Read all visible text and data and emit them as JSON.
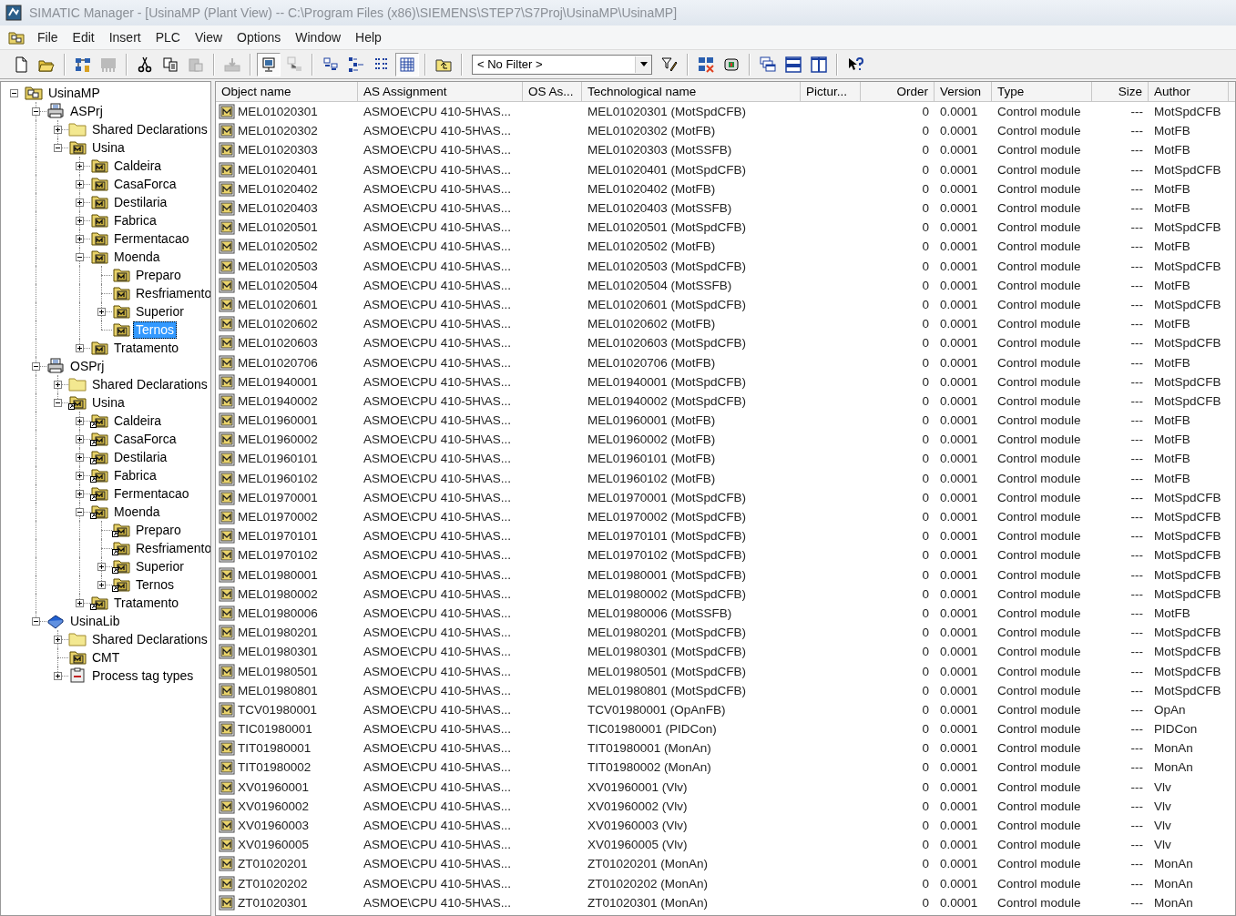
{
  "window": {
    "title": "SIMATIC Manager - [UsinaMP (Plant View) -- C:\\Program Files (x86)\\SIEMENS\\STEP7\\S7Proj\\UsinaMP\\UsinaMP]"
  },
  "menu": [
    "File",
    "Edit",
    "Insert",
    "PLC",
    "View",
    "Options",
    "Window",
    "Help"
  ],
  "toolbar": [
    {
      "kind": "new",
      "disabled": false,
      "pressed": false
    },
    {
      "kind": "open",
      "disabled": false,
      "pressed": false
    },
    {
      "kind": "separator"
    },
    {
      "kind": "network",
      "disabled": false,
      "pressed": false
    },
    {
      "kind": "simulate",
      "disabled": true,
      "pressed": false
    },
    {
      "kind": "separator"
    },
    {
      "kind": "cut",
      "disabled": false,
      "pressed": false
    },
    {
      "kind": "copy",
      "disabled": false,
      "pressed": false
    },
    {
      "kind": "paste",
      "disabled": true,
      "pressed": false
    },
    {
      "kind": "separator"
    },
    {
      "kind": "download",
      "disabled": true,
      "pressed": false
    },
    {
      "kind": "separator"
    },
    {
      "kind": "online",
      "disabled": false,
      "pressed": true
    },
    {
      "kind": "offline",
      "disabled": true,
      "pressed": false
    },
    {
      "kind": "separator"
    },
    {
      "kind": "large-icons",
      "disabled": false,
      "pressed": false
    },
    {
      "kind": "small-icons",
      "disabled": false,
      "pressed": false
    },
    {
      "kind": "list",
      "disabled": false,
      "pressed": false
    },
    {
      "kind": "details",
      "disabled": false,
      "pressed": true
    },
    {
      "kind": "separator"
    },
    {
      "kind": "up-level",
      "disabled": false,
      "pressed": false
    },
    {
      "kind": "separator"
    },
    {
      "kind": "filter",
      "value": "< No Filter >"
    },
    {
      "kind": "filter-edit",
      "disabled": false,
      "pressed": false
    },
    {
      "kind": "separator"
    },
    {
      "kind": "config",
      "disabled": false,
      "pressed": false
    },
    {
      "kind": "module",
      "disabled": false,
      "pressed": false
    },
    {
      "kind": "separator"
    },
    {
      "kind": "cascade",
      "disabled": false,
      "pressed": false
    },
    {
      "kind": "tile-horizontal",
      "disabled": false,
      "pressed": false
    },
    {
      "kind": "tile-vertical",
      "disabled": false,
      "pressed": false
    },
    {
      "kind": "separator"
    },
    {
      "kind": "help",
      "disabled": false,
      "pressed": false
    }
  ],
  "tree": [
    {
      "label": "UsinaMP",
      "kind": "multiproject",
      "expanded": true,
      "selected": false,
      "children": [
        {
          "label": "ASPrj",
          "kind": "project",
          "expanded": true,
          "selected": false,
          "children": [
            {
              "label": "Shared Declarations",
              "kind": "folder",
              "expanded": false,
              "selected": false
            },
            {
              "label": "Usina",
              "kind": "plant",
              "expanded": true,
              "selected": false,
              "children": [
                {
                  "label": "Caldeira",
                  "kind": "plant",
                  "expanded": false,
                  "selected": false
                },
                {
                  "label": "CasaForca",
                  "kind": "plant",
                  "expanded": false,
                  "selected": false
                },
                {
                  "label": "Destilaria",
                  "kind": "plant",
                  "expanded": false,
                  "selected": false
                },
                {
                  "label": "Fabrica",
                  "kind": "plant",
                  "expanded": false,
                  "selected": false
                },
                {
                  "label": "Fermentacao",
                  "kind": "plant",
                  "expanded": false,
                  "selected": false
                },
                {
                  "label": "Moenda",
                  "kind": "plant",
                  "expanded": true,
                  "selected": false,
                  "children": [
                    {
                      "label": "Preparo",
                      "kind": "plant",
                      "selected": false
                    },
                    {
                      "label": "Resfriamento",
                      "kind": "plant",
                      "selected": false
                    },
                    {
                      "label": "Superior",
                      "kind": "plant",
                      "expanded": false,
                      "selected": false
                    },
                    {
                      "label": "Ternos",
                      "kind": "plant",
                      "selected": true
                    }
                  ]
                },
                {
                  "label": "Tratamento",
                  "kind": "plant",
                  "expanded": false,
                  "selected": false
                }
              ]
            }
          ]
        },
        {
          "label": "OSPrj",
          "kind": "project",
          "expanded": true,
          "selected": false,
          "children": [
            {
              "label": "Shared Declarations",
              "kind": "folder",
              "expanded": false,
              "selected": false
            },
            {
              "label": "Usina",
              "kind": "plant-link",
              "expanded": true,
              "selected": false,
              "children": [
                {
                  "label": "Caldeira",
                  "kind": "plant-link",
                  "expanded": false,
                  "selected": false
                },
                {
                  "label": "CasaForca",
                  "kind": "plant-link",
                  "expanded": false,
                  "selected": false
                },
                {
                  "label": "Destilaria",
                  "kind": "plant-link",
                  "expanded": false,
                  "selected": false
                },
                {
                  "label": "Fabrica",
                  "kind": "plant-link",
                  "expanded": false,
                  "selected": false
                },
                {
                  "label": "Fermentacao",
                  "kind": "plant-link",
                  "expanded": false,
                  "selected": false
                },
                {
                  "label": "Moenda",
                  "kind": "plant-link",
                  "expanded": true,
                  "selected": false,
                  "children": [
                    {
                      "label": "Preparo",
                      "kind": "plant-link",
                      "selected": false
                    },
                    {
                      "label": "Resfriamento",
                      "kind": "plant-link",
                      "selected": false
                    },
                    {
                      "label": "Superior",
                      "kind": "plant-link",
                      "expanded": false,
                      "selected": false
                    },
                    {
                      "label": "Ternos",
                      "kind": "plant-link",
                      "expanded": false,
                      "selected": false
                    }
                  ]
                },
                {
                  "label": "Tratamento",
                  "kind": "plant-link",
                  "expanded": false,
                  "selected": false
                }
              ]
            }
          ]
        },
        {
          "label": "UsinaLib",
          "kind": "library",
          "expanded": true,
          "selected": false,
          "children": [
            {
              "label": "Shared Declarations",
              "kind": "folder",
              "expanded": false,
              "selected": false
            },
            {
              "label": "CMT",
              "kind": "plant",
              "selected": false
            },
            {
              "label": "Process tag types",
              "kind": "tag-types",
              "expanded": false,
              "selected": false
            }
          ]
        }
      ]
    }
  ],
  "table": {
    "columns": [
      "Object name",
      "AS Assignment",
      "OS As...",
      "Technological name",
      "Pictur...",
      "Order",
      "Version",
      "Type",
      "Size",
      "Author"
    ],
    "rows": [
      {
        "object_name": "MEL01020301",
        "as_assignment": "ASMOE\\CPU 410-5H\\AS...",
        "technological_name": "MEL01020301 (MotSpdCFB)",
        "order": "0",
        "version": "0.0001",
        "type": "Control module",
        "size": "---",
        "author": "MotSpdCFB"
      },
      {
        "object_name": "MEL01020302",
        "as_assignment": "ASMOE\\CPU 410-5H\\AS...",
        "technological_name": "MEL01020302 (MotFB)",
        "order": "0",
        "version": "0.0001",
        "type": "Control module",
        "size": "---",
        "author": "MotFB"
      },
      {
        "object_name": "MEL01020303",
        "as_assignment": "ASMOE\\CPU 410-5H\\AS...",
        "technological_name": "MEL01020303 (MotSSFB)",
        "order": "0",
        "version": "0.0001",
        "type": "Control module",
        "size": "---",
        "author": "MotFB"
      },
      {
        "object_name": "MEL01020401",
        "as_assignment": "ASMOE\\CPU 410-5H\\AS...",
        "technological_name": "MEL01020401 (MotSpdCFB)",
        "order": "0",
        "version": "0.0001",
        "type": "Control module",
        "size": "---",
        "author": "MotSpdCFB"
      },
      {
        "object_name": "MEL01020402",
        "as_assignment": "ASMOE\\CPU 410-5H\\AS...",
        "technological_name": "MEL01020402 (MotFB)",
        "order": "0",
        "version": "0.0001",
        "type": "Control module",
        "size": "---",
        "author": "MotFB"
      },
      {
        "object_name": "MEL01020403",
        "as_assignment": "ASMOE\\CPU 410-5H\\AS...",
        "technological_name": "MEL01020403 (MotSSFB)",
        "order": "0",
        "version": "0.0001",
        "type": "Control module",
        "size": "---",
        "author": "MotFB"
      },
      {
        "object_name": "MEL01020501",
        "as_assignment": "ASMOE\\CPU 410-5H\\AS...",
        "technological_name": "MEL01020501 (MotSpdCFB)",
        "order": "0",
        "version": "0.0001",
        "type": "Control module",
        "size": "---",
        "author": "MotSpdCFB"
      },
      {
        "object_name": "MEL01020502",
        "as_assignment": "ASMOE\\CPU 410-5H\\AS...",
        "technological_name": "MEL01020502 (MotFB)",
        "order": "0",
        "version": "0.0001",
        "type": "Control module",
        "size": "---",
        "author": "MotFB"
      },
      {
        "object_name": "MEL01020503",
        "as_assignment": "ASMOE\\CPU 410-5H\\AS...",
        "technological_name": "MEL01020503 (MotSpdCFB)",
        "order": "0",
        "version": "0.0001",
        "type": "Control module",
        "size": "---",
        "author": "MotSpdCFB"
      },
      {
        "object_name": "MEL01020504",
        "as_assignment": "ASMOE\\CPU 410-5H\\AS...",
        "technological_name": "MEL01020504 (MotSSFB)",
        "order": "0",
        "version": "0.0001",
        "type": "Control module",
        "size": "---",
        "author": "MotFB"
      },
      {
        "object_name": "MEL01020601",
        "as_assignment": "ASMOE\\CPU 410-5H\\AS...",
        "technological_name": "MEL01020601 (MotSpdCFB)",
        "order": "0",
        "version": "0.0001",
        "type": "Control module",
        "size": "---",
        "author": "MotSpdCFB"
      },
      {
        "object_name": "MEL01020602",
        "as_assignment": "ASMOE\\CPU 410-5H\\AS...",
        "technological_name": "MEL01020602 (MotFB)",
        "order": "0",
        "version": "0.0001",
        "type": "Control module",
        "size": "---",
        "author": "MotFB"
      },
      {
        "object_name": "MEL01020603",
        "as_assignment": "ASMOE\\CPU 410-5H\\AS...",
        "technological_name": "MEL01020603 (MotSpdCFB)",
        "order": "0",
        "version": "0.0001",
        "type": "Control module",
        "size": "---",
        "author": "MotSpdCFB"
      },
      {
        "object_name": "MEL01020706",
        "as_assignment": "ASMOE\\CPU 410-5H\\AS...",
        "technological_name": "MEL01020706 (MotFB)",
        "order": "0",
        "version": "0.0001",
        "type": "Control module",
        "size": "---",
        "author": "MotFB"
      },
      {
        "object_name": "MEL01940001",
        "as_assignment": "ASMOE\\CPU 410-5H\\AS...",
        "technological_name": "MEL01940001 (MotSpdCFB)",
        "order": "0",
        "version": "0.0001",
        "type": "Control module",
        "size": "---",
        "author": "MotSpdCFB"
      },
      {
        "object_name": "MEL01940002",
        "as_assignment": "ASMOE\\CPU 410-5H\\AS...",
        "technological_name": "MEL01940002 (MotSpdCFB)",
        "order": "0",
        "version": "0.0001",
        "type": "Control module",
        "size": "---",
        "author": "MotSpdCFB"
      },
      {
        "object_name": "MEL01960001",
        "as_assignment": "ASMOE\\CPU 410-5H\\AS...",
        "technological_name": "MEL01960001 (MotFB)",
        "order": "0",
        "version": "0.0001",
        "type": "Control module",
        "size": "---",
        "author": "MotFB"
      },
      {
        "object_name": "MEL01960002",
        "as_assignment": "ASMOE\\CPU 410-5H\\AS...",
        "technological_name": "MEL01960002 (MotFB)",
        "order": "0",
        "version": "0.0001",
        "type": "Control module",
        "size": "---",
        "author": "MotFB"
      },
      {
        "object_name": "MEL01960101",
        "as_assignment": "ASMOE\\CPU 410-5H\\AS...",
        "technological_name": "MEL01960101 (MotFB)",
        "order": "0",
        "version": "0.0001",
        "type": "Control module",
        "size": "---",
        "author": "MotFB"
      },
      {
        "object_name": "MEL01960102",
        "as_assignment": "ASMOE\\CPU 410-5H\\AS...",
        "technological_name": "MEL01960102 (MotFB)",
        "order": "0",
        "version": "0.0001",
        "type": "Control module",
        "size": "---",
        "author": "MotFB"
      },
      {
        "object_name": "MEL01970001",
        "as_assignment": "ASMOE\\CPU 410-5H\\AS...",
        "technological_name": "MEL01970001 (MotSpdCFB)",
        "order": "0",
        "version": "0.0001",
        "type": "Control module",
        "size": "---",
        "author": "MotSpdCFB"
      },
      {
        "object_name": "MEL01970002",
        "as_assignment": "ASMOE\\CPU 410-5H\\AS...",
        "technological_name": "MEL01970002 (MotSpdCFB)",
        "order": "0",
        "version": "0.0001",
        "type": "Control module",
        "size": "---",
        "author": "MotSpdCFB"
      },
      {
        "object_name": "MEL01970101",
        "as_assignment": "ASMOE\\CPU 410-5H\\AS...",
        "technological_name": "MEL01970101 (MotSpdCFB)",
        "order": "0",
        "version": "0.0001",
        "type": "Control module",
        "size": "---",
        "author": "MotSpdCFB"
      },
      {
        "object_name": "MEL01970102",
        "as_assignment": "ASMOE\\CPU 410-5H\\AS...",
        "technological_name": "MEL01970102 (MotSpdCFB)",
        "order": "0",
        "version": "0.0001",
        "type": "Control module",
        "size": "---",
        "author": "MotSpdCFB"
      },
      {
        "object_name": "MEL01980001",
        "as_assignment": "ASMOE\\CPU 410-5H\\AS...",
        "technological_name": "MEL01980001 (MotSpdCFB)",
        "order": "0",
        "version": "0.0001",
        "type": "Control module",
        "size": "---",
        "author": "MotSpdCFB"
      },
      {
        "object_name": "MEL01980002",
        "as_assignment": "ASMOE\\CPU 410-5H\\AS...",
        "technological_name": "MEL01980002 (MotSpdCFB)",
        "order": "0",
        "version": "0.0001",
        "type": "Control module",
        "size": "---",
        "author": "MotSpdCFB"
      },
      {
        "object_name": "MEL01980006",
        "as_assignment": "ASMOE\\CPU 410-5H\\AS...",
        "technological_name": "MEL01980006 (MotSSFB)",
        "order": "0",
        "version": "0.0001",
        "type": "Control module",
        "size": "---",
        "author": "MotFB"
      },
      {
        "object_name": "MEL01980201",
        "as_assignment": "ASMOE\\CPU 410-5H\\AS...",
        "technological_name": "MEL01980201 (MotSpdCFB)",
        "order": "0",
        "version": "0.0001",
        "type": "Control module",
        "size": "---",
        "author": "MotSpdCFB"
      },
      {
        "object_name": "MEL01980301",
        "as_assignment": "ASMOE\\CPU 410-5H\\AS...",
        "technological_name": "MEL01980301 (MotSpdCFB)",
        "order": "0",
        "version": "0.0001",
        "type": "Control module",
        "size": "---",
        "author": "MotSpdCFB"
      },
      {
        "object_name": "MEL01980501",
        "as_assignment": "ASMOE\\CPU 410-5H\\AS...",
        "technological_name": "MEL01980501 (MotSpdCFB)",
        "order": "0",
        "version": "0.0001",
        "type": "Control module",
        "size": "---",
        "author": "MotSpdCFB"
      },
      {
        "object_name": "MEL01980801",
        "as_assignment": "ASMOE\\CPU 410-5H\\AS...",
        "technological_name": "MEL01980801 (MotSpdCFB)",
        "order": "0",
        "version": "0.0001",
        "type": "Control module",
        "size": "---",
        "author": "MotSpdCFB"
      },
      {
        "object_name": "TCV01980001",
        "as_assignment": "ASMOE\\CPU 410-5H\\AS...",
        "technological_name": "TCV01980001 (OpAnFB)",
        "order": "0",
        "version": "0.0001",
        "type": "Control module",
        "size": "---",
        "author": "OpAn"
      },
      {
        "object_name": "TIC01980001",
        "as_assignment": "ASMOE\\CPU 410-5H\\AS...",
        "technological_name": "TIC01980001 (PIDCon)",
        "order": "0",
        "version": "0.0001",
        "type": "Control module",
        "size": "---",
        "author": "PIDCon"
      },
      {
        "object_name": "TIT01980001",
        "as_assignment": "ASMOE\\CPU 410-5H\\AS...",
        "technological_name": "TIT01980001 (MonAn)",
        "order": "0",
        "version": "0.0001",
        "type": "Control module",
        "size": "---",
        "author": "MonAn"
      },
      {
        "object_name": "TIT01980002",
        "as_assignment": "ASMOE\\CPU 410-5H\\AS...",
        "technological_name": "TIT01980002 (MonAn)",
        "order": "0",
        "version": "0.0001",
        "type": "Control module",
        "size": "---",
        "author": "MonAn"
      },
      {
        "object_name": "XV01960001",
        "as_assignment": "ASMOE\\CPU 410-5H\\AS...",
        "technological_name": "XV01960001 (Vlv)",
        "order": "0",
        "version": "0.0001",
        "type": "Control module",
        "size": "---",
        "author": "Vlv"
      },
      {
        "object_name": "XV01960002",
        "as_assignment": "ASMOE\\CPU 410-5H\\AS...",
        "technological_name": "XV01960002 (Vlv)",
        "order": "0",
        "version": "0.0001",
        "type": "Control module",
        "size": "---",
        "author": "Vlv"
      },
      {
        "object_name": "XV01960003",
        "as_assignment": "ASMOE\\CPU 410-5H\\AS...",
        "technological_name": "XV01960003 (Vlv)",
        "order": "0",
        "version": "0.0001",
        "type": "Control module",
        "size": "---",
        "author": "Vlv"
      },
      {
        "object_name": "XV01960005",
        "as_assignment": "ASMOE\\CPU 410-5H\\AS...",
        "technological_name": "XV01960005 (Vlv)",
        "order": "0",
        "version": "0.0001",
        "type": "Control module",
        "size": "---",
        "author": "Vlv"
      },
      {
        "object_name": "ZT01020201",
        "as_assignment": "ASMOE\\CPU 410-5H\\AS...",
        "technological_name": "ZT01020201 (MonAn)",
        "order": "0",
        "version": "0.0001",
        "type": "Control module",
        "size": "---",
        "author": "MonAn"
      },
      {
        "object_name": "ZT01020202",
        "as_assignment": "ASMOE\\CPU 410-5H\\AS...",
        "technological_name": "ZT01020202 (MonAn)",
        "order": "0",
        "version": "0.0001",
        "type": "Control module",
        "size": "---",
        "author": "MonAn"
      },
      {
        "object_name": "ZT01020301",
        "as_assignment": "ASMOE\\CPU 410-5H\\AS...",
        "technological_name": "ZT01020301 (MonAn)",
        "order": "0",
        "version": "0.0001",
        "type": "Control module",
        "size": "---",
        "author": "MonAn"
      }
    ]
  }
}
